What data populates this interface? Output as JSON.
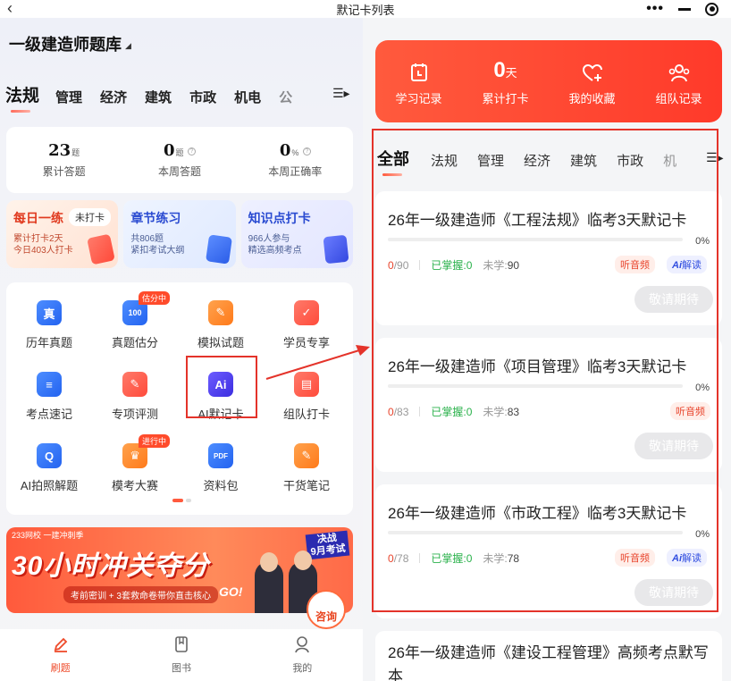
{
  "window": {
    "title": "默记卡列表",
    "back": "‹"
  },
  "left": {
    "bank_title": "一级建造师题库",
    "subjects": [
      "法规",
      "管理",
      "经济",
      "建筑",
      "市政",
      "机电",
      "公"
    ],
    "stats": [
      {
        "num": "23",
        "unit": "题",
        "label": "累计答题"
      },
      {
        "num": "0",
        "unit": "题",
        "label": "本周答题"
      },
      {
        "num": "0",
        "unit": "%",
        "label": "本周正确率"
      }
    ],
    "cards": [
      {
        "title": "每日一练",
        "pill": "未打卡",
        "line1": "累计打卡2天",
        "line2": "今日403人打卡"
      },
      {
        "title": "章节练习",
        "line1": "共806题",
        "line2": "紧扣考试大纲"
      },
      {
        "title": "知识点打卡",
        "line1": "966人参与",
        "line2": "精选高频考点"
      }
    ],
    "grid": [
      {
        "label": "历年真题",
        "glyph": "真"
      },
      {
        "label": "真题估分",
        "glyph": "100",
        "tag": "估分中"
      },
      {
        "label": "模拟试题",
        "glyph": "✎"
      },
      {
        "label": "学员专享",
        "glyph": "✓"
      },
      {
        "label": "考点速记",
        "glyph": "≡"
      },
      {
        "label": "专项评测",
        "glyph": "✎"
      },
      {
        "label": "AI默记卡",
        "glyph": "Ai"
      },
      {
        "label": "组队打卡",
        "glyph": "▤"
      },
      {
        "label": "AI拍照解题",
        "glyph": "Q"
      },
      {
        "label": "模考大赛",
        "glyph": "♛",
        "tag": "进行中"
      },
      {
        "label": "资料包",
        "glyph": "PDF"
      },
      {
        "label": "干货笔记",
        "glyph": "✎"
      }
    ],
    "banner": {
      "top": "233网校   一建冲刺季",
      "headline": "30小时冲关夺分",
      "sub": "考前密训 + 3套救命卷带你直击核心",
      "go": "GO!",
      "tag": "决战\n9月考试",
      "consult": "咨询"
    },
    "tabbar": [
      {
        "label": "刷题",
        "active": true
      },
      {
        "label": "图书",
        "active": false
      },
      {
        "label": "我的",
        "active": false
      }
    ]
  },
  "right": {
    "hero": [
      {
        "label": "学习记录",
        "icon": "calendar-icon"
      },
      {
        "label": "累计打卡",
        "value": "0",
        "unit": "天"
      },
      {
        "label": "我的收藏",
        "icon": "heart-plus-icon"
      },
      {
        "label": "组队记录",
        "icon": "team-icon"
      }
    ],
    "tabs": [
      "全部",
      "法规",
      "管理",
      "经济",
      "建筑",
      "市政",
      "机"
    ],
    "items": [
      {
        "title": "26年一级建造师《工程法规》临考3天默记卡",
        "progress": "0%",
        "done": "0",
        "total": "/90",
        "mastered": "已掌握:0",
        "unlearned_label": "未学:",
        "unlearned": "90",
        "audio": "听音频",
        "ai": "解读",
        "ai_prefix": "Ai",
        "button": "敬请期待"
      },
      {
        "title": "26年一级建造师《项目管理》临考3天默记卡",
        "progress": "0%",
        "done": "0",
        "total": "/83",
        "mastered": "已掌握:0",
        "unlearned_label": "未学:",
        "unlearned": "83",
        "audio": "听音频",
        "button": "敬请期待"
      },
      {
        "title": "26年一级建造师《市政工程》临考3天默记卡",
        "progress": "0%",
        "done": "0",
        "total": "/78",
        "mastered": "已掌握:0",
        "unlearned_label": "未学:",
        "unlearned": "78",
        "audio": "听音频",
        "ai": "解读",
        "ai_prefix": "Ai",
        "button": "敬请期待"
      },
      {
        "title": "26年一级建造师《建设工程管理》高频考点默写本"
      }
    ]
  },
  "colors": {
    "accent": "#ff3a2a",
    "highlight": "#e4332a",
    "green": "#2bb24c",
    "ai_blue": "#3350e0"
  }
}
